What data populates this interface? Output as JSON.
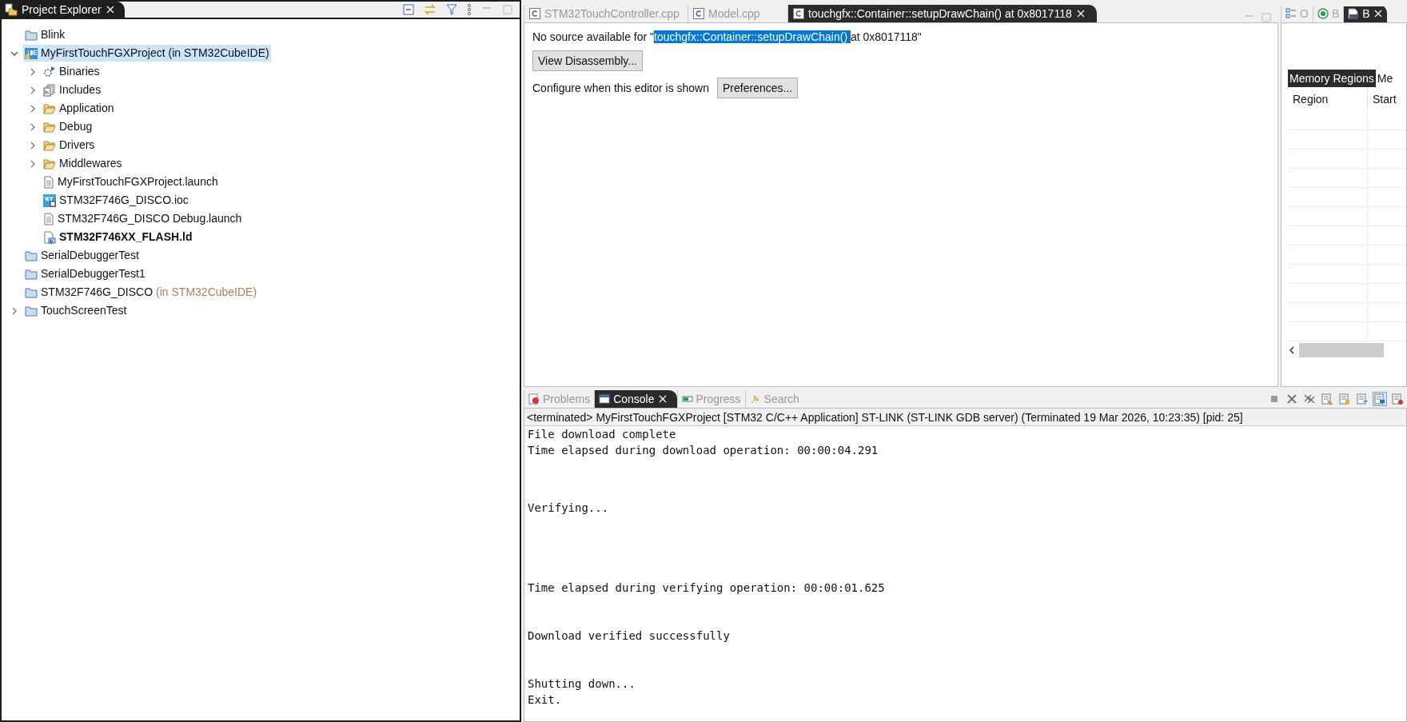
{
  "project_explorer": {
    "title": "Project Explorer",
    "selected": true,
    "tree": [
      {
        "label": "Blink",
        "kind": "project",
        "bold": false,
        "selected": false
      },
      {
        "label": "MyFirstTouchFGXProject",
        "suffix": "(in STM32CubeIDE)",
        "kind": "ideproject",
        "bold": false,
        "selected": true,
        "expanded": true,
        "children": [
          {
            "label": "Binaries",
            "kind": "binaries",
            "bold": false,
            "selected": false,
            "expanded": false
          },
          {
            "label": "Includes",
            "kind": "includes",
            "bold": false,
            "selected": false,
            "expanded": false
          },
          {
            "label": "Application",
            "kind": "folder",
            "bold": false,
            "selected": false,
            "expanded": false
          },
          {
            "label": "Debug",
            "kind": "folder",
            "bold": false,
            "selected": false,
            "expanded": false
          },
          {
            "label": "Drivers",
            "kind": "folder",
            "bold": false,
            "selected": false,
            "expanded": false
          },
          {
            "label": "Middlewares",
            "kind": "folder",
            "bold": false,
            "selected": false,
            "expanded": false
          },
          {
            "label": "MyFirstTouchFGXProject.launch",
            "kind": "file",
            "bold": false,
            "selected": false
          },
          {
            "label": "STM32F746G_DISCO.ioc",
            "kind": "ioc",
            "bold": false,
            "selected": false
          },
          {
            "label": "STM32F746G_DISCO Debug.launch",
            "kind": "file",
            "bold": false,
            "selected": false
          },
          {
            "label": "STM32F746XX_FLASH.ld",
            "kind": "linker",
            "bold": true,
            "selected": false
          }
        ]
      },
      {
        "label": "SerialDebuggerTest",
        "kind": "project",
        "bold": false,
        "selected": false
      },
      {
        "label": "SerialDebuggerTest1",
        "kind": "project",
        "bold": false,
        "selected": false
      },
      {
        "label": "STM32F746G_DISCO",
        "suffix": "(in STM32CubeIDE)",
        "kind": "project",
        "bold": false,
        "selected": false
      },
      {
        "label": "TouchScreenTest",
        "kind": "project",
        "bold": false,
        "selected": false,
        "expanded": false
      }
    ]
  },
  "editor": {
    "tabs": [
      {
        "label": "STM32TouchController.cpp",
        "selected": false
      },
      {
        "label": "Model.cpp",
        "selected": false
      },
      {
        "label": "touchgfx::Container::setupDrawChain() at 0x8017118",
        "selected": true
      }
    ],
    "message": [
      {
        "text": "No source available for \"",
        "selected": false
      },
      {
        "text": "touchgfx::Container::setupDrawChain() ",
        "selected": true
      },
      {
        "text": "at 0x8017118\"",
        "selected": false
      }
    ],
    "disassembly_button": "View Disassembly...",
    "configure_label": "Configure when this editor is shown",
    "preferences_button": "Preferences..."
  },
  "side_panel": {
    "tabs": [
      {
        "label": "O",
        "kind": "outline",
        "selected": false
      },
      {
        "label": "B",
        "kind": "target",
        "selected": false
      },
      {
        "label": "B",
        "kind": "binary",
        "selected": true
      }
    ],
    "subtabs": [
      {
        "label": "Memory Regions",
        "selected": true
      },
      {
        "label": "Me",
        "selected": false
      }
    ],
    "columns": [
      "Region",
      "Start"
    ]
  },
  "console": {
    "tabs": [
      {
        "label": "Problems",
        "kind": "problems",
        "selected": false
      },
      {
        "label": "Console",
        "kind": "console",
        "selected": true
      },
      {
        "label": "Progress",
        "kind": "progress",
        "selected": false
      },
      {
        "label": "Search",
        "kind": "search",
        "selected": false
      }
    ],
    "status": "<terminated> MyFirstTouchFGXProject [STM32 C/C++ Application] ST-LINK (ST-LINK GDB server) (Terminated 19 Mar 2026, 10:23:35) [pid: 25]",
    "lines": [
      "File download complete",
      "Time elapsed during download operation: 00:00:04.291",
      "Verifying...",
      "Time elapsed during verifying operation: 00:00:01.625",
      "Download verified successfully",
      "Shutting down...",
      "Exit."
    ]
  }
}
